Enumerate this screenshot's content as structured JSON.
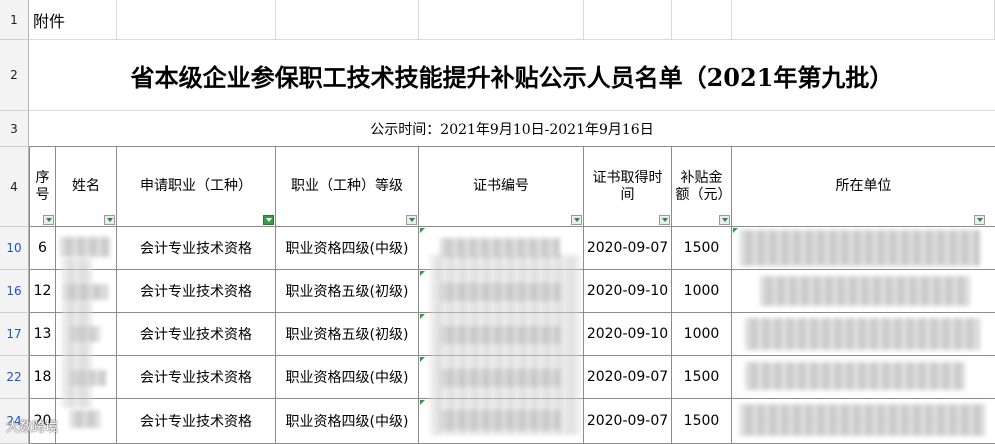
{
  "row_headers": [
    "1",
    "2",
    "3",
    "4",
    "10",
    "16",
    "17",
    "22",
    "24"
  ],
  "attachment_label": "附件",
  "title": "省本级企业参保职工技术技能提升补贴公示人员名单（2021年第九批）",
  "publish_time": "公示时间：2021年9月10日-2021年9月16日",
  "columns": [
    "序号",
    "姓名",
    "申请职业（工种）",
    "职业（工种）等级",
    "证书编号",
    "证书取得时间",
    "补贴金额（元）",
    "所在单位"
  ],
  "rows": [
    {
      "no": "6",
      "occupation": "会计专业技术资格",
      "level": "职业资格四级(中级)",
      "date": "2020-09-07",
      "amount": "1500"
    },
    {
      "no": "12",
      "occupation": "会计专业技术资格",
      "level": "职业资格五级(初级)",
      "date": "2020-09-10",
      "amount": "1000"
    },
    {
      "no": "13",
      "occupation": "会计专业技术资格",
      "level": "职业资格五级(初级)",
      "date": "2020-09-10",
      "amount": "1000"
    },
    {
      "no": "18",
      "occupation": "会计专业技术资格",
      "level": "职业资格四级(中级)",
      "date": "2020-09-07",
      "amount": "1500"
    },
    {
      "no": "20",
      "occupation": "会计专业技术资格",
      "level": "职业资格四级(中级)",
      "date": "2020-09-07",
      "amount": "1500"
    }
  ],
  "watermark": "大数跨境",
  "colors": {
    "filter_active": "#3a9a4a",
    "filtered_row_number": "#1a55c8"
  }
}
